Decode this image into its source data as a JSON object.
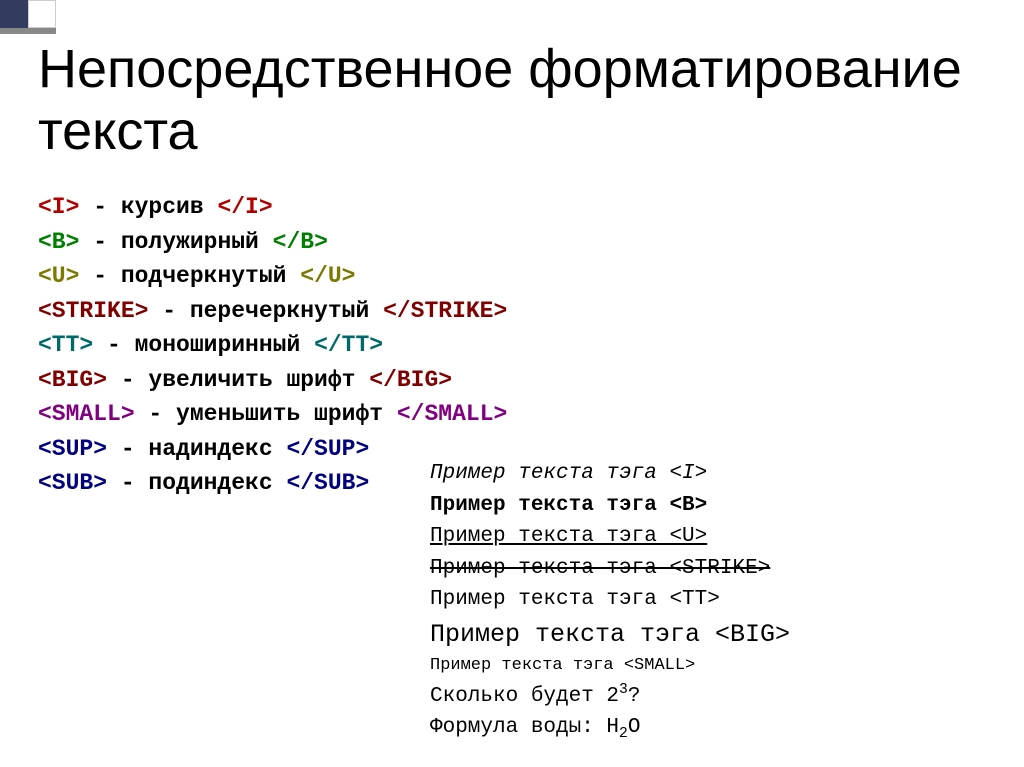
{
  "title": "Непосредственное форматирование текста",
  "tags": [
    {
      "open": "<I>",
      "desc": " - курсив ",
      "close": "</I>",
      "cls": "t-red"
    },
    {
      "open": "<B>",
      "desc": " - полужирный ",
      "close": "</B>",
      "cls": "t-green"
    },
    {
      "open": "<U>",
      "desc": " - подчеркнутый ",
      "close": "</U>",
      "cls": "t-olive"
    },
    {
      "open": "<STRIKE>",
      "desc": " - перечеркнутый ",
      "close": "</STRIKE>",
      "cls": "t-maroon"
    },
    {
      "open": "<TT>",
      "desc": " - моноширинный ",
      "close": "</TT>",
      "cls": "t-teal"
    },
    {
      "open": "<BIG>",
      "desc": " - увеличить шрифт ",
      "close": "</BIG>",
      "cls": "t-maroon"
    },
    {
      "open": "<SMALL>",
      "desc": " - уменьшить шрифт ",
      "close": "</SMALL>",
      "cls": "t-purple"
    },
    {
      "open": "<SUP>",
      "desc": " - надиндекс ",
      "close": "</SUP>",
      "cls": "t-navy"
    },
    {
      "open": "<SUB>",
      "desc": " - подиндекс ",
      "close": "</SUB>",
      "cls": "t-navy"
    }
  ],
  "examples": {
    "prefix": "Пример текста тэга ",
    "i": "<I>",
    "b": "<B>",
    "u": "<U>",
    "s": "<STRIKE>",
    "tt": "<TT>",
    "big": "<BIG>",
    "small": "<SMALL>",
    "q1a": "Сколько будет 2",
    "q1sup": "3",
    "q1b": "?",
    "q2a": "Формула воды: H",
    "q2sub": "2",
    "q2b": "O"
  }
}
